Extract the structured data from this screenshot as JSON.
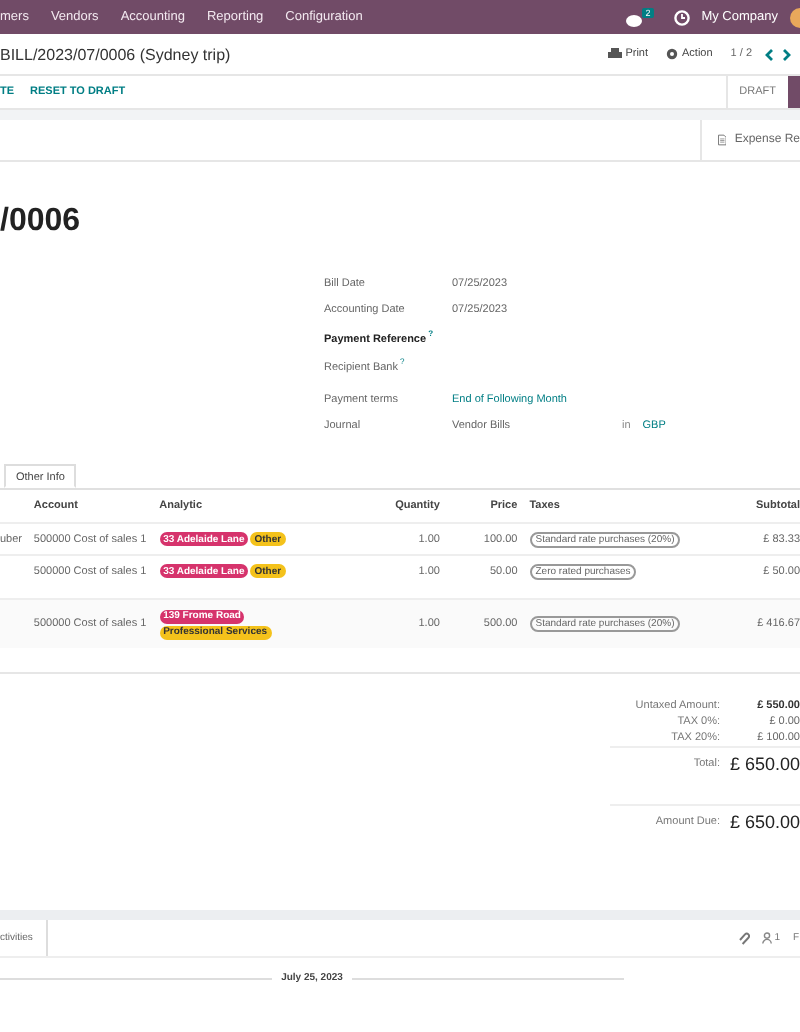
{
  "top_nav": {
    "items": [
      "mers",
      "Vendors",
      "Accounting",
      "Reporting",
      "Configuration"
    ],
    "message_count": "2",
    "company": "My Company"
  },
  "breadcrumb": "BILL/2023/07/0006 (Sydney trip)",
  "actions": {
    "print": "Print",
    "action": "Action",
    "pager": "1 / 2"
  },
  "status_buttons": [
    "TE",
    "RESET TO DRAFT"
  ],
  "status": "DRAFT",
  "smart_button": "Expense Re",
  "title": "/0006",
  "fields": [
    {
      "kind": "plain",
      "label": "Bill Date",
      "value": "07/25/2023"
    },
    {
      "kind": "plain",
      "label": "Accounting Date",
      "value": "07/25/2023"
    },
    {
      "kind": "required",
      "label": "Payment Reference",
      "help": "?"
    },
    {
      "kind": "plain",
      "label": "Recipient Bank",
      "help": "?"
    },
    {
      "kind": "link",
      "label": "Payment terms",
      "value": "End of Following Month"
    },
    {
      "kind": "journal",
      "label": "Journal",
      "value": "Vendor Bills",
      "joiner": "in",
      "currency": "GBP"
    }
  ],
  "tabs": [
    {
      "label": "Other Info",
      "selected": true
    }
  ],
  "table": {
    "columns": [
      "Account",
      "Analytic",
      "Quantity",
      "Price",
      "Taxes",
      "Subtotal"
    ],
    "rows": [
      {
        "label": "uber",
        "account": "500000 Cost of sales 1",
        "analytic": [
          {
            "label": "33 Adelaide Lane",
            "color": "#d6336c"
          },
          {
            "label": "Other",
            "color": "#f4c21b"
          }
        ],
        "quantity": "1.00",
        "price": "100.00",
        "taxes": "Standard rate purchases (20%)",
        "subtotal": "£ 83.33"
      },
      {
        "account": "500000 Cost of sales 1",
        "analytic": [
          {
            "label": "33 Adelaide Lane",
            "color": "#d6336c"
          },
          {
            "label": "Other",
            "color": "#f4c21b"
          }
        ],
        "quantity": "1.00",
        "price": "50.00",
        "taxes": "Zero rated purchases",
        "subtotal": "£ 50.00"
      },
      {
        "account": "500000 Cost of sales 1",
        "analytic": [
          {
            "label": "139 Frome Road",
            "color": "#d6336c"
          },
          {
            "label": "Professional Services",
            "color": "#f4c21b"
          }
        ],
        "quantity": "1.00",
        "price": "500.00",
        "taxes": "Standard rate purchases (20%)",
        "subtotal": "£ 416.67"
      }
    ]
  },
  "totals": [
    {
      "kind": "bold",
      "label": "Untaxed Amount:",
      "value": "£ 550.00"
    },
    {
      "kind": "plain",
      "label": "TAX 0%:",
      "value": "£ 0.00"
    },
    {
      "kind": "plain",
      "label": "TAX 20%:",
      "value": "£ 100.00"
    },
    {
      "kind": "total",
      "label": "Total:",
      "value": "£ 650.00"
    }
  ],
  "amount_due": {
    "label": "Amount Due:",
    "value": "£ 650.00"
  },
  "chatter": {
    "tab": "ctivities",
    "followers": "1",
    "follow": "F"
  },
  "date_separator": "July 25, 2023"
}
